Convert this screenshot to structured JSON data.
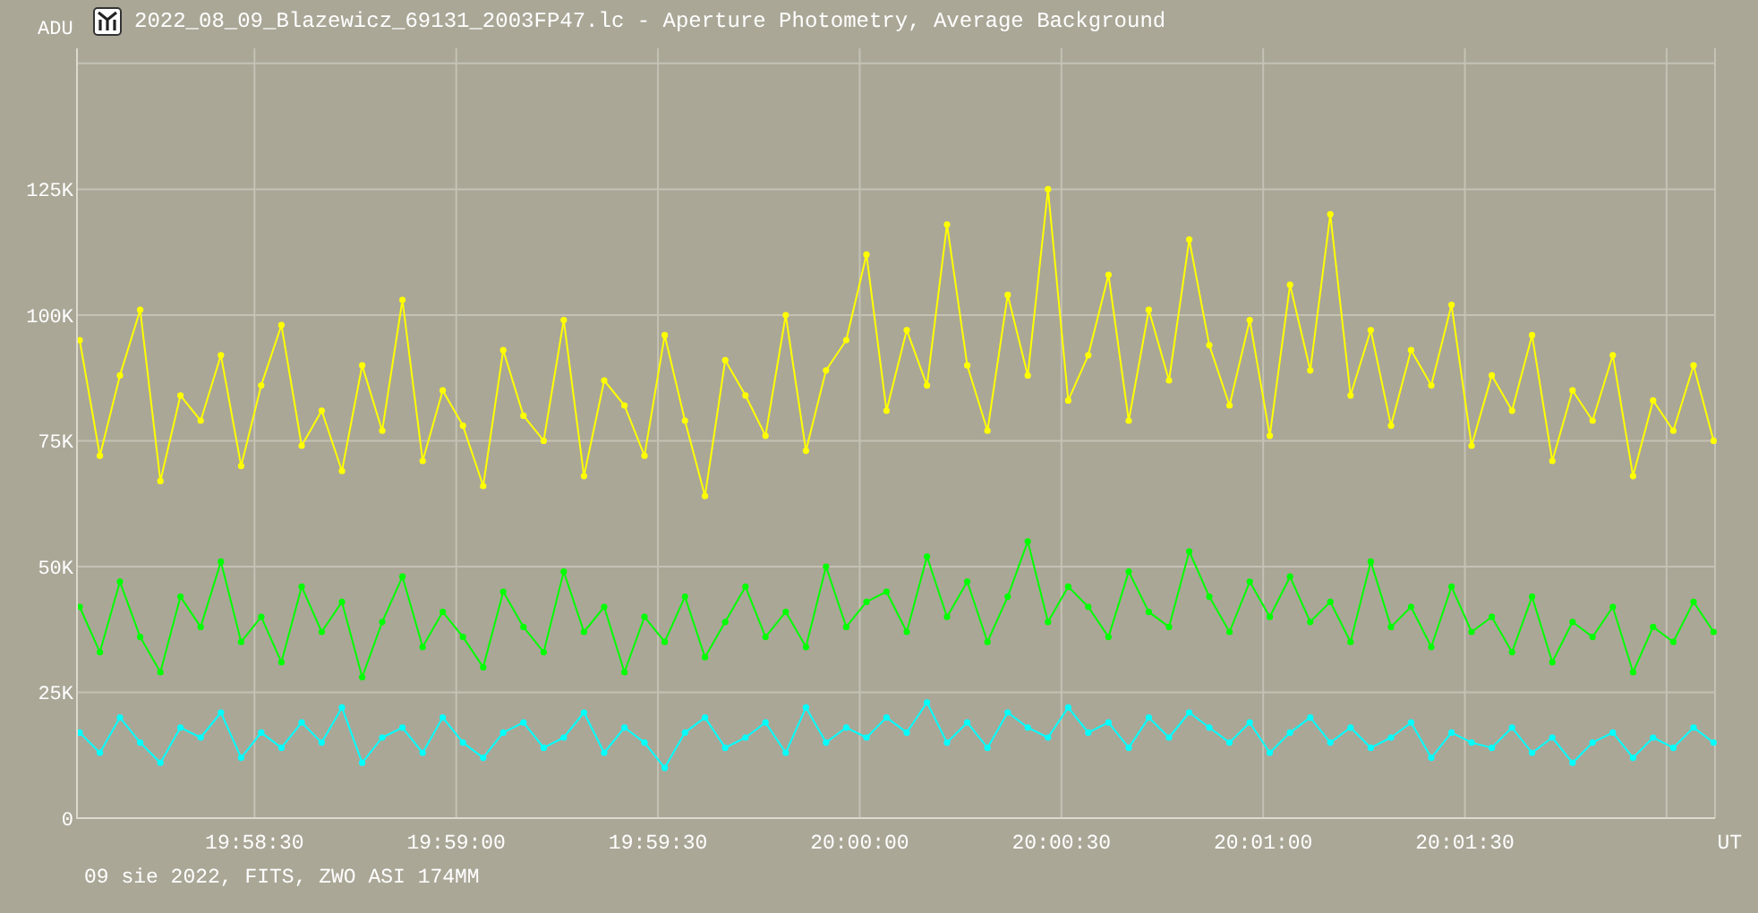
{
  "window": {
    "title": "2022_08_09_Blazewicz_69131_2003FP47.lc - Aperture Photometry, Average Background"
  },
  "chart_data": {
    "type": "line",
    "grid": true,
    "xlabel": "UT",
    "ylabel": "ADU",
    "xlim": [
      71883.6,
      72127.2
    ],
    "ylim": [
      0,
      153
    ],
    "x": [
      71884,
      71887,
      71890,
      71893,
      71896,
      71899,
      71902,
      71905,
      71908,
      71911,
      71914,
      71917,
      71920,
      71923,
      71926,
      71929,
      71932,
      71935,
      71938,
      71941,
      71944,
      71947,
      71950,
      71953,
      71956,
      71959,
      71962,
      71965,
      71968,
      71971,
      71974,
      71977,
      71980,
      71983,
      71986,
      71989,
      71992,
      71995,
      71998,
      72001,
      72004,
      72007,
      72010,
      72013,
      72016,
      72019,
      72022,
      72025,
      72028,
      72031,
      72034,
      72037,
      72040,
      72043,
      72046,
      72049,
      72052,
      72055,
      72058,
      72061,
      72064,
      72067,
      72070,
      72073,
      72076,
      72079,
      72082,
      72085,
      72088,
      72091,
      72094,
      72097,
      72100,
      72103,
      72106,
      72109,
      72112,
      72115,
      72118,
      72121,
      72124,
      72127
    ],
    "xticks": [
      {
        "value": 71910,
        "label": "19:58:30"
      },
      {
        "value": 71940,
        "label": "19:59:00"
      },
      {
        "value": 71970,
        "label": "19:59:30"
      },
      {
        "value": 72000,
        "label": "20:00:00"
      },
      {
        "value": 72030,
        "label": "20:00:30"
      },
      {
        "value": 72060,
        "label": "20:01:00"
      },
      {
        "value": 72090,
        "label": "20:01:30"
      }
    ],
    "yticks": [
      {
        "value": 0,
        "label": "0"
      },
      {
        "value": 25,
        "label": "25K"
      },
      {
        "value": 50,
        "label": "50K"
      },
      {
        "value": 75,
        "label": "75K"
      },
      {
        "value": 100,
        "label": "100K"
      },
      {
        "value": 125,
        "label": "125K"
      }
    ],
    "series": [
      {
        "color": "#ffff00",
        "marker": "circle",
        "values": [
          95,
          72,
          88,
          101,
          67,
          84,
          79,
          92,
          70,
          86,
          98,
          74,
          81,
          69,
          90,
          77,
          103,
          71,
          85,
          78,
          66,
          93,
          80,
          75,
          99,
          68,
          87,
          82,
          72,
          96,
          79,
          64,
          91,
          84,
          76,
          100,
          73,
          89,
          95,
          112,
          81,
          97,
          86,
          118,
          90,
          77,
          104,
          88,
          125,
          83,
          92,
          108,
          79,
          101,
          87,
          115,
          94,
          82,
          99,
          76,
          106,
          89,
          120,
          84,
          97,
          78,
          93,
          86,
          102,
          74,
          88,
          81,
          96,
          71,
          85,
          79,
          92,
          68,
          83,
          77,
          90,
          75
        ]
      },
      {
        "color": "#00ff00",
        "marker": "circle",
        "values": [
          42,
          33,
          47,
          36,
          29,
          44,
          38,
          51,
          35,
          40,
          31,
          46,
          37,
          43,
          28,
          39,
          48,
          34,
          41,
          36,
          30,
          45,
          38,
          33,
          49,
          37,
          42,
          29,
          40,
          35,
          44,
          32,
          39,
          46,
          36,
          41,
          34,
          50,
          38,
          43,
          45,
          37,
          52,
          40,
          47,
          35,
          44,
          55,
          39,
          46,
          42,
          36,
          49,
          41,
          38,
          53,
          44,
          37,
          47,
          40,
          48,
          39,
          43,
          35,
          51,
          38,
          42,
          34,
          46,
          37,
          40,
          33,
          44,
          31,
          39,
          36,
          42,
          29,
          38,
          35,
          43,
          37
        ]
      },
      {
        "color": "#00ffff",
        "marker": "circle",
        "values": [
          17,
          13,
          20,
          15,
          11,
          18,
          16,
          21,
          12,
          17,
          14,
          19,
          15,
          22,
          11,
          16,
          18,
          13,
          20,
          15,
          12,
          17,
          19,
          14,
          16,
          21,
          13,
          18,
          15,
          10,
          17,
          20,
          14,
          16,
          19,
          13,
          22,
          15,
          18,
          16,
          20,
          17,
          23,
          15,
          19,
          14,
          21,
          18,
          16,
          22,
          17,
          19,
          14,
          20,
          16,
          21,
          18,
          15,
          19,
          13,
          17,
          20,
          15,
          18,
          14,
          16,
          19,
          12,
          17,
          15,
          14,
          18,
          13,
          16,
          11,
          15,
          17,
          12,
          16,
          14,
          18,
          15
        ]
      }
    ]
  },
  "footer": "09 sie 2022, FITS, ZWO ASI 174MM"
}
